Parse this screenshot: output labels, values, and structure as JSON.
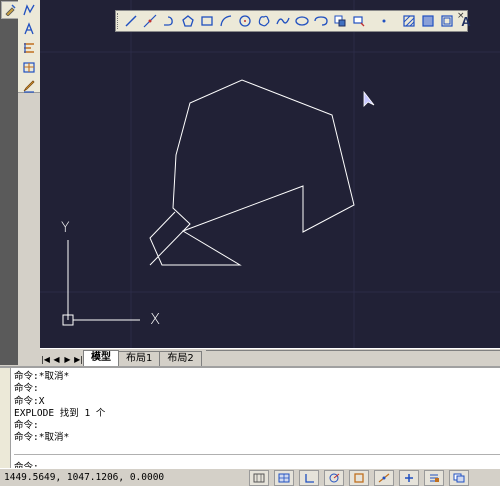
{
  "colors": {
    "canvas_bg": "#212136",
    "geometry_line": "#ffffff",
    "grid_line": "#2b2b44",
    "toolbar_bg": "#ece9d8",
    "command_bg": "#ffffff"
  },
  "draw_toolbar": {
    "tools": [
      "line-icon",
      "construction-line-icon",
      "polyline-icon",
      "polygon-icon",
      "rectangle-icon",
      "arc-icon",
      "circle-icon",
      "revision-cloud-icon",
      "spline-icon",
      "ellipse-icon",
      "ellipse-arc-icon",
      "insert-block-icon",
      "make-block-icon",
      "point-icon",
      "hatch-icon",
      "gradient-icon",
      "region-icon",
      "multiline-text-icon"
    ],
    "text_tool_label": "A"
  },
  "left_toolbar": {
    "tools": [
      "dimension-icon",
      "text-style-icon",
      "multiline-icon",
      "table-icon",
      "pencil-icon"
    ]
  },
  "ucs": {
    "x_label": "X",
    "y_label": "Y"
  },
  "layout_tabs": {
    "tabs": [
      {
        "label": "模型",
        "active": true
      },
      {
        "label": "布局1",
        "active": false
      },
      {
        "label": "布局2",
        "active": false
      }
    ]
  },
  "command_window": {
    "history": [
      "命令:*取消*",
      "命令:",
      "命令:X",
      "EXPLODE 找到 1 个",
      "命令:",
      "命令:*取消*"
    ],
    "prompt": "命令:"
  },
  "status_bar": {
    "coordinates": "1449.5649, 1047.1206, 0.0000",
    "toggles": [
      "snap-icon",
      "grid-icon",
      "ortho-icon",
      "polar-icon",
      "osnap-icon",
      "otrack-icon",
      "ducs-icon",
      "lineweight-icon",
      "model-icon"
    ]
  }
}
